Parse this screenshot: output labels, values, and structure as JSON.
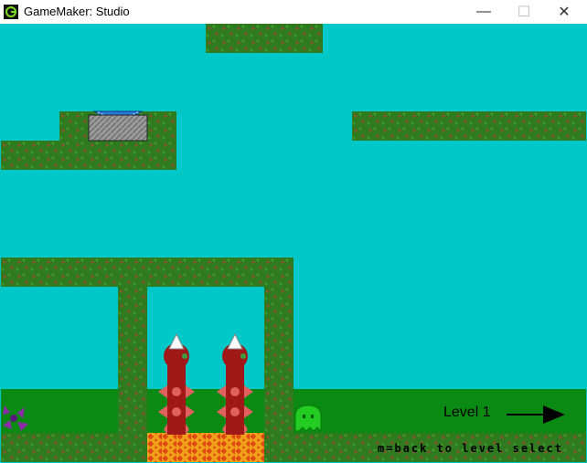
{
  "window": {
    "title": "GameMaker: Studio",
    "controls": {
      "minimize": "—",
      "maximize": "☐",
      "close": "✕"
    }
  },
  "game": {
    "level_label": "Level 1",
    "hint": "m=back to level select",
    "colors": {
      "sky": "#00c8c8",
      "bush": "#2f7a1f",
      "grass": "#0a8a12",
      "lava": "#e04a10",
      "player": "#22cc22",
      "enemy": "#a01818"
    }
  }
}
